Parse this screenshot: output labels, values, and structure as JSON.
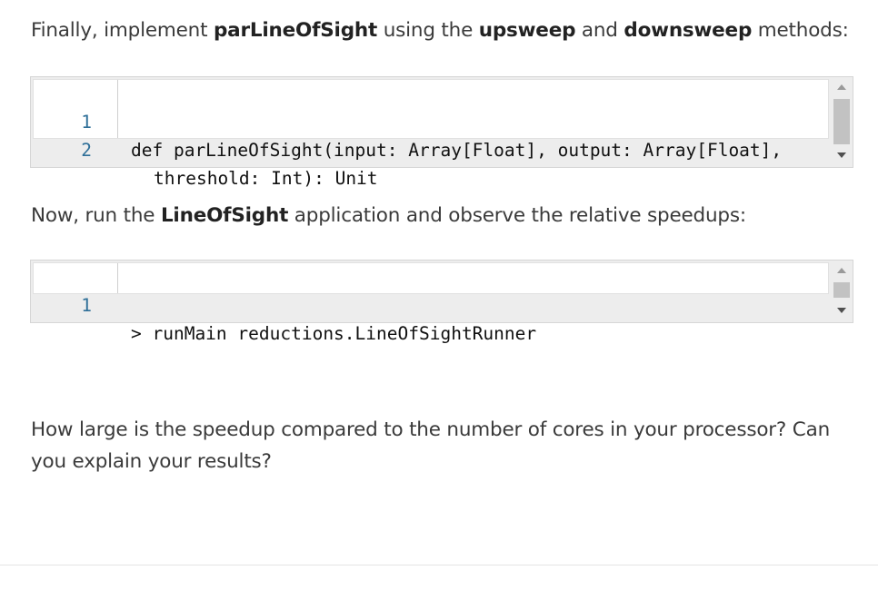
{
  "para1": {
    "t1": "Finally, implement ",
    "b1": "parLineOfSight",
    "t2": " using the ",
    "b2": "upsweep",
    "t3": " and ",
    "b3": "downsweep",
    "t4": " methods:"
  },
  "code1": {
    "lines": [
      {
        "num": "1",
        "code": "def parLineOfSight(input: Array[Float], output: Array[Float],"
      },
      {
        "num": "2",
        "code": "threshold: Int): Unit"
      }
    ]
  },
  "para2": {
    "t1": "Now, run the ",
    "b1": "LineOfSight",
    "t2": " application and observe the relative speedups:"
  },
  "code2": {
    "lines": [
      {
        "num": "1",
        "code": "> runMain reductions.LineOfSightRunner"
      }
    ]
  },
  "para3": {
    "text": "How large is the speedup compared to the number of cores in your processor? Can you explain your results?"
  }
}
